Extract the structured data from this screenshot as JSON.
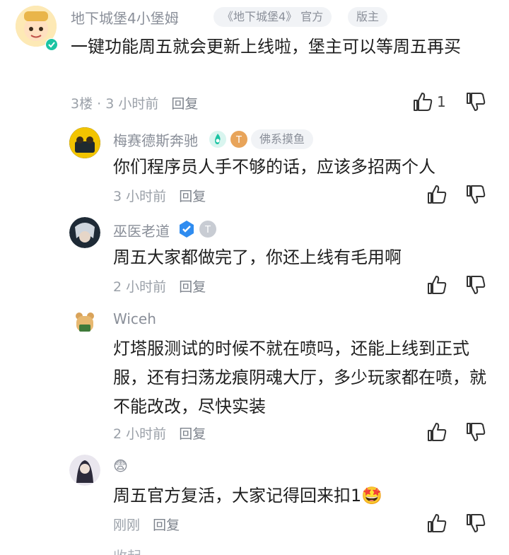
{
  "comments": [
    {
      "user": "地下城堡4小堡姆",
      "tags": [
        "《地下城堡4》 官方",
        "版主"
      ],
      "text": "一键功能周五就会更新上线啦，堡主可以等周五再买",
      "floor": "3楼",
      "time": "3 小时前",
      "reply": "回复",
      "likes": "1"
    },
    {
      "user": "梅赛德斯奔驰",
      "tags": [
        "佛系摸鱼"
      ],
      "text": "你们程序员人手不够的话，应该多招两个人",
      "time": "3 小时前",
      "reply": "回复"
    },
    {
      "user": "巫医老道",
      "text": "周五大家都做完了，你还上线有毛用啊",
      "time": "2 小时前",
      "reply": "回复"
    },
    {
      "user": "Wiceh",
      "text": "灯塔服测试的时候不就在喷吗，还能上线到正式服，还有扫荡龙痕阴魂大厅，多少玩家都在喷，就不能改改，尽快实装",
      "time": "2 小时前",
      "reply": "回复"
    },
    {
      "user": "😨",
      "text": "周五官方复活，大家记得回来扣1🤩",
      "time": "刚刚",
      "reply": "回复"
    }
  ],
  "collapse_label": "收起",
  "colors": {
    "accent_green": "#1bc4a3",
    "blue_badge": "#2f8cf0",
    "gold_badge": "#e8a45a"
  }
}
